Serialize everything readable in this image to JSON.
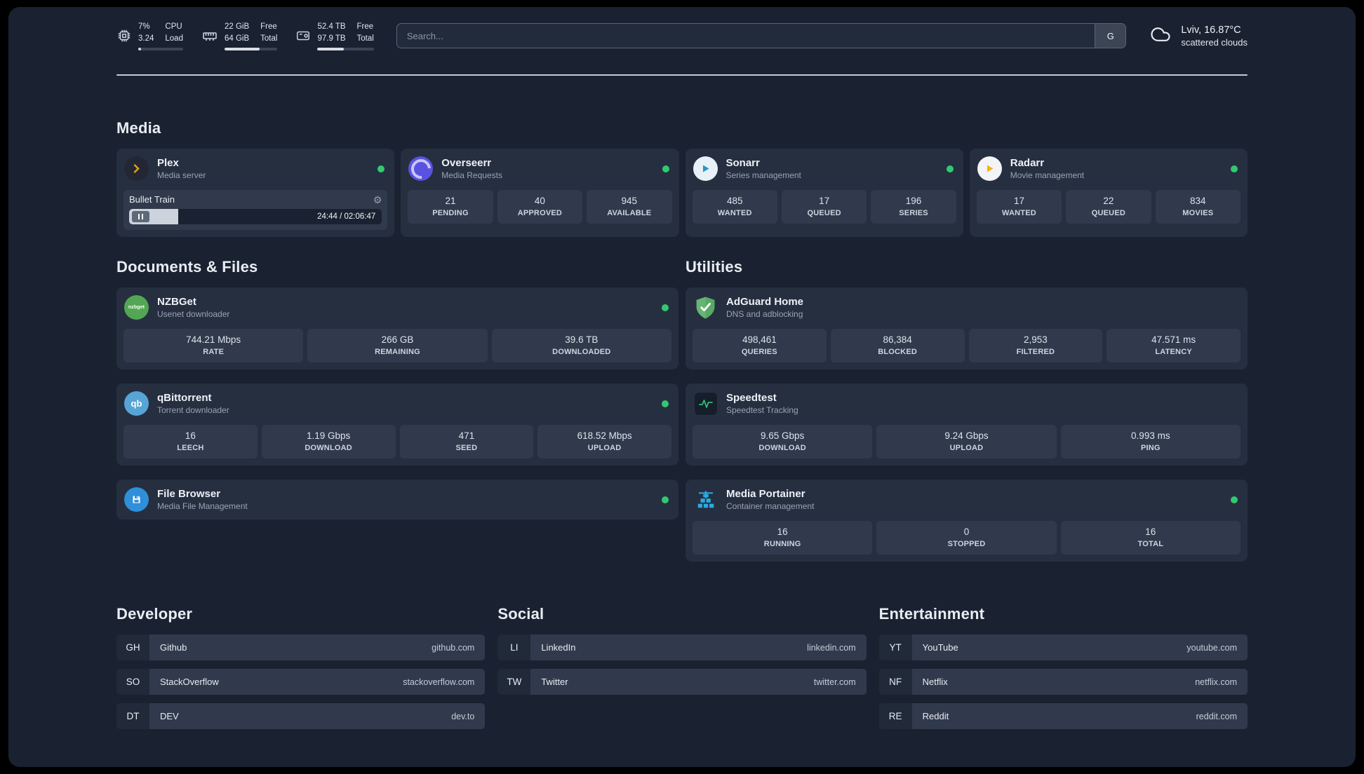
{
  "topbar": {
    "metrics": [
      {
        "name": "cpu",
        "line1": "7%",
        "line2": "3.24",
        "label1": "CPU",
        "label2": "Load",
        "percent": 7
      },
      {
        "name": "memory",
        "line1": "22 GiB",
        "line2": "64 GiB",
        "label1": "Free",
        "label2": "Total",
        "percent": 66
      },
      {
        "name": "storage",
        "line1": "52.4 TB",
        "line2": "97.9 TB",
        "label1": "Free",
        "label2": "Total",
        "percent": 47
      }
    ],
    "search": {
      "placeholder": "Search...",
      "button_label": "G"
    },
    "weather": {
      "location": "Lviv, 16.87°C",
      "condition": "scattered clouds"
    }
  },
  "sections": {
    "media": {
      "title": "Media"
    },
    "documents": {
      "title": "Documents & Files"
    },
    "utilities": {
      "title": "Utilities"
    },
    "developer": {
      "title": "Developer"
    },
    "social": {
      "title": "Social"
    },
    "entertainment": {
      "title": "Entertainment"
    }
  },
  "apps": {
    "plex": {
      "name": "Plex",
      "subtitle": "Media server",
      "now_playing": {
        "title": "Bullet Train",
        "time": "24:44 / 02:06:47",
        "progress_percent": 19.5
      }
    },
    "overseerr": {
      "name": "Overseerr",
      "subtitle": "Media Requests",
      "stats": [
        {
          "value": "21",
          "label": "PENDING"
        },
        {
          "value": "40",
          "label": "APPROVED"
        },
        {
          "value": "945",
          "label": "AVAILABLE"
        }
      ]
    },
    "sonarr": {
      "name": "Sonarr",
      "subtitle": "Series management",
      "stats": [
        {
          "value": "485",
          "label": "WANTED"
        },
        {
          "value": "17",
          "label": "QUEUED"
        },
        {
          "value": "196",
          "label": "SERIES"
        }
      ]
    },
    "radarr": {
      "name": "Radarr",
      "subtitle": "Movie management",
      "stats": [
        {
          "value": "17",
          "label": "WANTED"
        },
        {
          "value": "22",
          "label": "QUEUED"
        },
        {
          "value": "834",
          "label": "MOVIES"
        }
      ]
    },
    "nzbget": {
      "name": "NZBGet",
      "subtitle": "Usenet downloader",
      "icon_label": "nzbget",
      "stats": [
        {
          "value": "744.21 Mbps",
          "label": "RATE"
        },
        {
          "value": "266 GB",
          "label": "REMAINING"
        },
        {
          "value": "39.6 TB",
          "label": "DOWNLOADED"
        }
      ]
    },
    "qbittorrent": {
      "name": "qBittorrent",
      "subtitle": "Torrent downloader",
      "icon_label": "qb",
      "stats": [
        {
          "value": "16",
          "label": "LEECH"
        },
        {
          "value": "1.19 Gbps",
          "label": "DOWNLOAD"
        },
        {
          "value": "471",
          "label": "SEED"
        },
        {
          "value": "618.52 Mbps",
          "label": "UPLOAD"
        }
      ]
    },
    "filebrowser": {
      "name": "File Browser",
      "subtitle": "Media File Management"
    },
    "adguard": {
      "name": "AdGuard Home",
      "subtitle": "DNS and adblocking",
      "stats": [
        {
          "value": "498,461",
          "label": "QUERIES"
        },
        {
          "value": "86,384",
          "label": "BLOCKED"
        },
        {
          "value": "2,953",
          "label": "FILTERED"
        },
        {
          "value": "47.571 ms",
          "label": "LATENCY"
        }
      ]
    },
    "speedtest": {
      "name": "Speedtest",
      "subtitle": "Speedtest Tracking",
      "stats": [
        {
          "value": "9.65 Gbps",
          "label": "DOWNLOAD"
        },
        {
          "value": "9.24 Gbps",
          "label": "UPLOAD"
        },
        {
          "value": "0.993 ms",
          "label": "PING"
        }
      ]
    },
    "portainer": {
      "name": "Media Portainer",
      "subtitle": "Container management",
      "stats": [
        {
          "value": "16",
          "label": "RUNNING"
        },
        {
          "value": "0",
          "label": "STOPPED"
        },
        {
          "value": "16",
          "label": "TOTAL"
        }
      ]
    }
  },
  "bookmarks": {
    "developer": [
      {
        "abbr": "GH",
        "name": "Github",
        "url": "github.com"
      },
      {
        "abbr": "SO",
        "name": "StackOverflow",
        "url": "stackoverflow.com"
      },
      {
        "abbr": "DT",
        "name": "DEV",
        "url": "dev.to"
      }
    ],
    "social": [
      {
        "abbr": "LI",
        "name": "LinkedIn",
        "url": "linkedin.com"
      },
      {
        "abbr": "TW",
        "name": "Twitter",
        "url": "twitter.com"
      }
    ],
    "entertainment": [
      {
        "abbr": "YT",
        "name": "YouTube",
        "url": "youtube.com"
      },
      {
        "abbr": "NF",
        "name": "Netflix",
        "url": "netflix.com"
      },
      {
        "abbr": "RE",
        "name": "Reddit",
        "url": "reddit.com"
      }
    ]
  },
  "colors": {
    "background": "#1a2231",
    "card": "#262f40",
    "tile": "#303a4c",
    "online_green": "#2fca70",
    "plex_amber": "#e5a00d"
  }
}
